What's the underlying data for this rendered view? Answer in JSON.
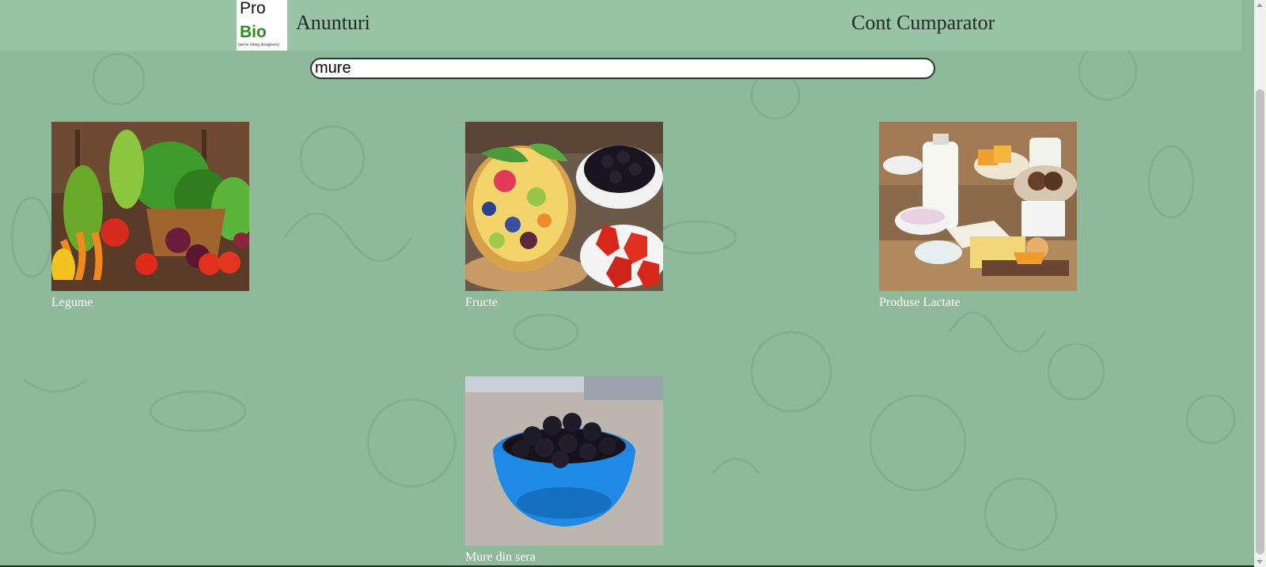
{
  "logo": {
    "line1": "Pro",
    "line2": "Bio",
    "tagline": "(we're hiring designers)"
  },
  "nav": {
    "anunturi": "Anunturi",
    "cont": "Cont Cumparator"
  },
  "search": {
    "value": "mure"
  },
  "categories": [
    {
      "label": "Legume"
    },
    {
      "label": "Fructe"
    },
    {
      "label": "Produse Lactate"
    },
    {
      "label": "Mure din sera"
    }
  ],
  "colors": {
    "background": "#8fb99b",
    "header": "#99c3a7",
    "label": "#ffffff"
  }
}
